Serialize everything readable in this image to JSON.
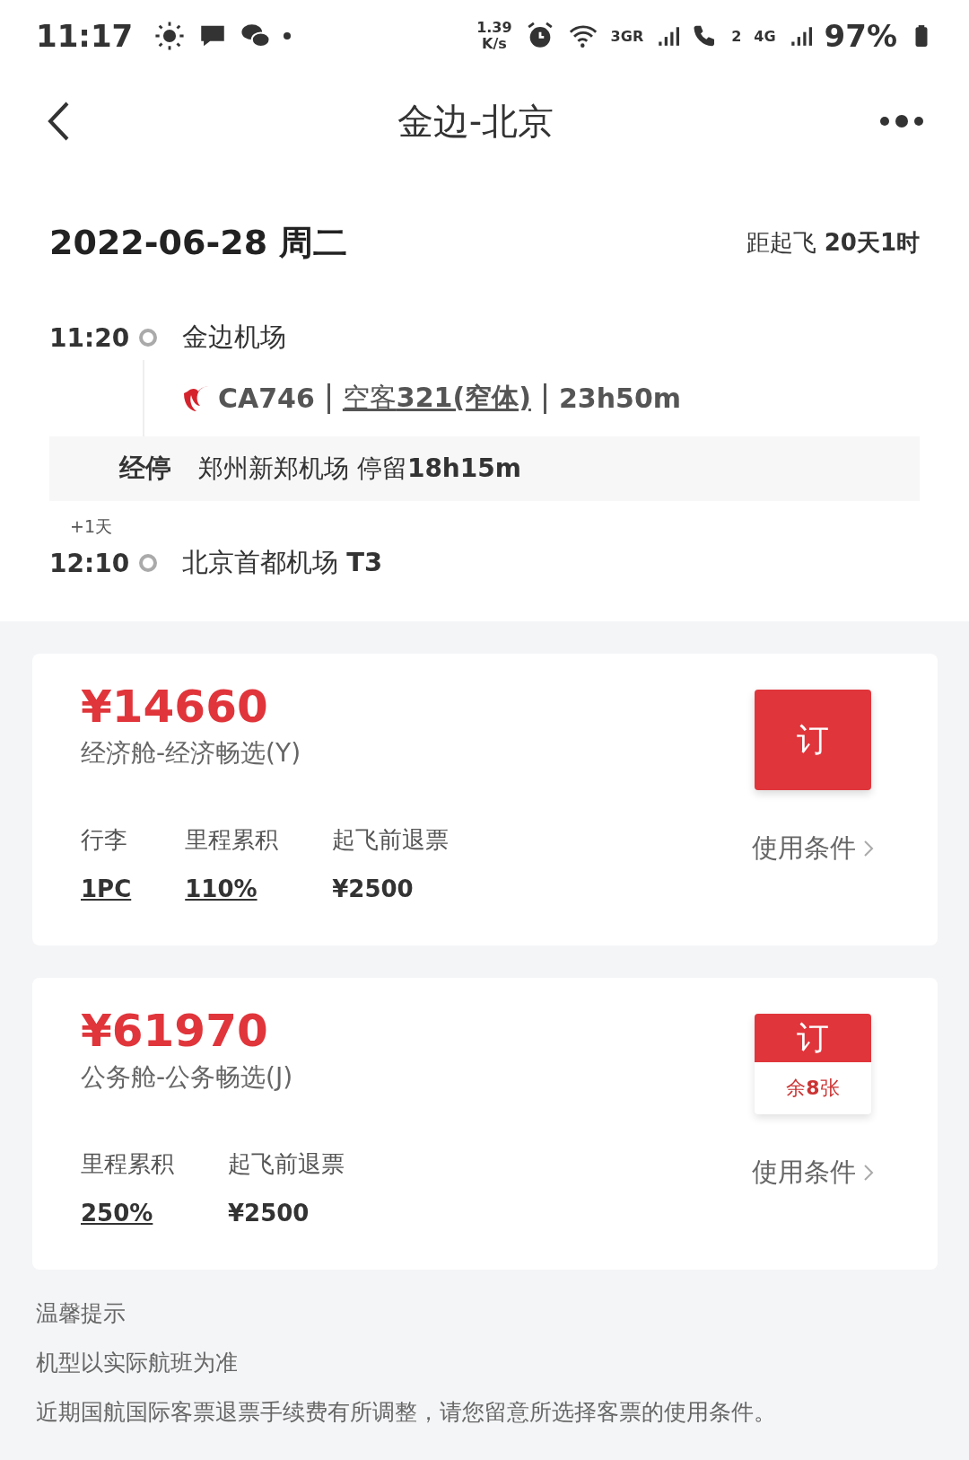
{
  "status_bar": {
    "time": "11:17",
    "net_speed": [
      "1.39",
      "K/s"
    ],
    "sim1": "3GR",
    "sim2_index": "2",
    "sim2": "4G",
    "battery": "97%"
  },
  "header": {
    "title": "金边-北京"
  },
  "date_row": {
    "date": "2022-06-28 周二",
    "countdown": "距起飞 **20天1时**"
  },
  "itinerary": {
    "depart": {
      "time": "11:20",
      "airport": "金边机场"
    },
    "flight": {
      "number": "CA746",
      "aircraft": "空客**321(窄体)**",
      "duration": "23h50m"
    },
    "stop": {
      "label": "经停",
      "detail": "郑州新郑机场 停留**18h15m**"
    },
    "arrive": {
      "day_offset": "+1天",
      "time": "12:10",
      "airport": "北京首都机场 **T3**"
    }
  },
  "fares": [
    {
      "price": "¥14660",
      "cabin": "经济舱-经济畅选(Y)",
      "book": "订",
      "terms": "使用条件",
      "attributes": [
        {
          "label": "行李",
          "value": "1PC",
          "underlined": true
        },
        {
          "label": "里程累积",
          "value": "110%",
          "underlined": true
        },
        {
          "label": "起飞前退票",
          "value": "¥2500",
          "underlined": false
        }
      ]
    },
    {
      "price": "¥61970",
      "cabin": "公务舱-公务畅选(J)",
      "book": "订",
      "remaining": "余**8**张",
      "terms": "使用条件",
      "attributes": [
        {
          "label": "里程累积",
          "value": "250%",
          "underlined": true
        },
        {
          "label": "起飞前退票",
          "value": "¥2500",
          "underlined": false
        }
      ]
    }
  ],
  "tips": [
    "温馨提示",
    "机型以实际航班为准",
    "近期国航国际客票退票手续费有所调整，请您留意所选择客票的使用条件。"
  ]
}
